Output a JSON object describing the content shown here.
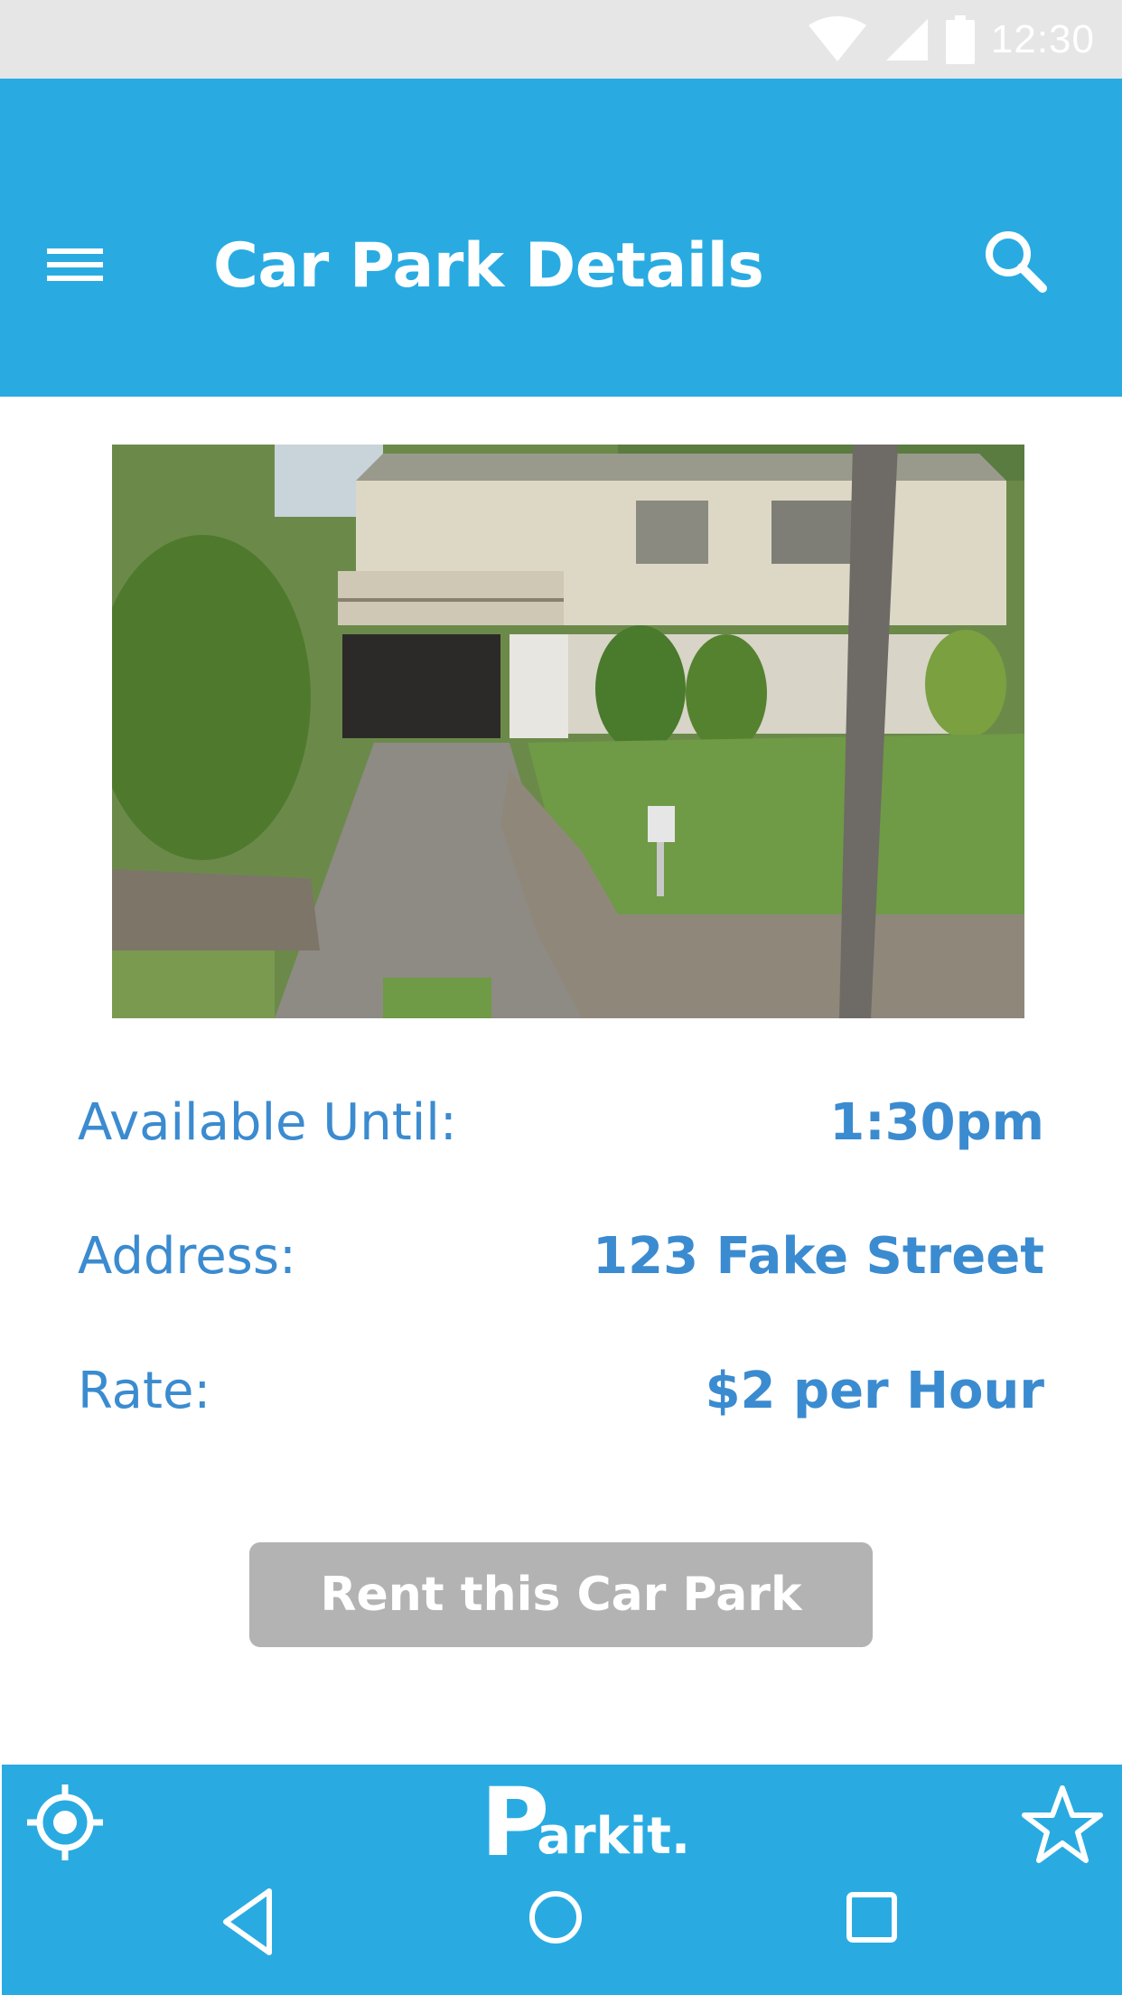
{
  "status_bar": {
    "time": "12:30",
    "icons": [
      "wifi-icon",
      "signal-icon",
      "battery-icon"
    ]
  },
  "header": {
    "title": "Car Park Details",
    "menu_icon": "hamburger-menu-icon",
    "search_icon": "search-icon"
  },
  "details": [
    {
      "label": "Available Until:",
      "value": "1:30pm"
    },
    {
      "label": "Address:",
      "value": "123 Fake Street"
    },
    {
      "label": "Rate:",
      "value": "$2 per Hour"
    }
  ],
  "actions": {
    "rent_label": "Rent this Car Park"
  },
  "bottom_bar": {
    "logo_initial": "P",
    "logo_rest": "arkit.",
    "left_icon": "locate-icon",
    "right_icon": "star-icon",
    "nav_icons": [
      "back-icon",
      "home-icon",
      "recent-apps-icon"
    ]
  },
  "colors": {
    "primary": "#29abe2",
    "text_accent": "#3b8bd0",
    "button_disabled": "#b3b3b3",
    "status_bar": "#e6e6e6"
  }
}
